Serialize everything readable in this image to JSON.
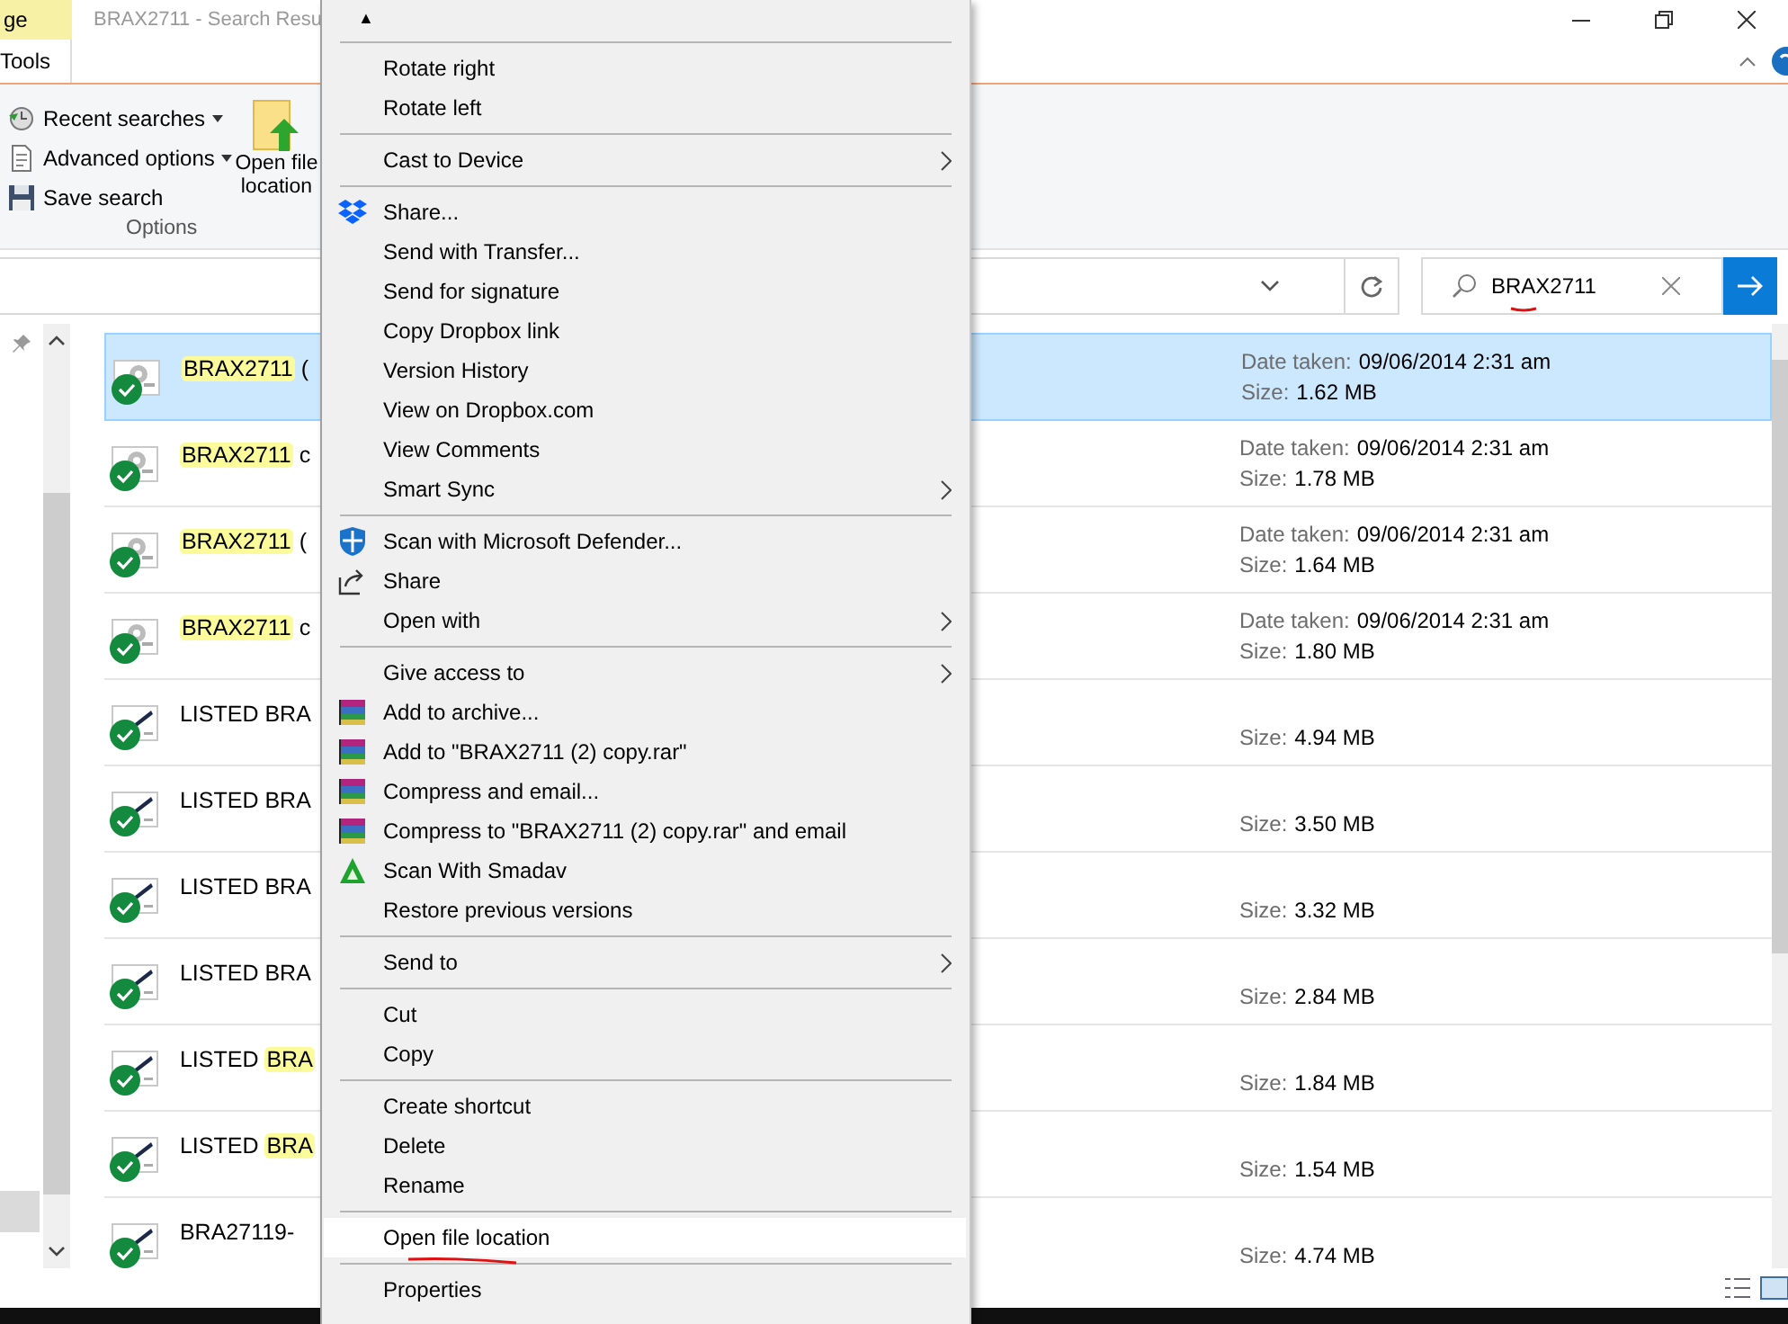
{
  "title_bar": {
    "context_tab": "ge",
    "title": "BRAX2711 - Search Resu"
  },
  "ribbon": {
    "tab": "Tools",
    "group_label": "Options",
    "commands": [
      {
        "label": "Recent searches",
        "kind": "clock",
        "dropdown": true
      },
      {
        "label": "Advanced options",
        "kind": "document",
        "dropdown": true
      },
      {
        "label": "Save search",
        "kind": "disk",
        "dropdown": false
      }
    ],
    "big_command": {
      "label": "Open file location"
    }
  },
  "search": {
    "value": "BRAX2711",
    "underlined": true
  },
  "files": [
    {
      "name": [
        {
          "text": "BRAX2711",
          "match": true
        },
        {
          "text": " (",
          "match": false
        }
      ],
      "selected": true,
      "kind": "gear",
      "date_label": "Date taken:",
      "date": "09/06/2014 2:31 am",
      "size_label": "Size:",
      "size": "1.62 MB"
    },
    {
      "name": [
        {
          "text": "BRAX2711",
          "match": true
        },
        {
          "text": " c",
          "match": false
        }
      ],
      "selected": false,
      "kind": "gear",
      "date_label": "Date taken:",
      "date": "09/06/2014 2:31 am",
      "size_label": "Size:",
      "size": "1.78 MB"
    },
    {
      "name": [
        {
          "text": "BRAX2711",
          "match": true
        },
        {
          "text": " (",
          "match": false
        }
      ],
      "selected": false,
      "kind": "gear",
      "date_label": "Date taken:",
      "date": "09/06/2014 2:31 am",
      "size_label": "Size:",
      "size": "1.64 MB"
    },
    {
      "name": [
        {
          "text": "BRAX2711",
          "match": true
        },
        {
          "text": " c",
          "match": false
        }
      ],
      "selected": false,
      "kind": "gear",
      "date_label": "Date taken:",
      "date": "09/06/2014 2:31 am",
      "size_label": "Size:",
      "size": "1.80 MB"
    },
    {
      "name": [
        {
          "text": "LISTED BRA",
          "match": false
        }
      ],
      "selected": false,
      "kind": "pen",
      "size_label": "Size:",
      "size": "4.94 MB"
    },
    {
      "name": [
        {
          "text": "LISTED BRA",
          "match": false
        }
      ],
      "selected": false,
      "kind": "pen",
      "size_label": "Size:",
      "size": "3.50 MB"
    },
    {
      "name": [
        {
          "text": "LISTED BRA",
          "match": false
        }
      ],
      "selected": false,
      "kind": "pen",
      "size_label": "Size:",
      "size": "3.32 MB"
    },
    {
      "name": [
        {
          "text": "LISTED BRA",
          "match": false
        }
      ],
      "selected": false,
      "kind": "pen",
      "size_label": "Size:",
      "size": "2.84 MB"
    },
    {
      "name": [
        {
          "text": "LISTED ",
          "match": false
        },
        {
          "text": "BRA",
          "match": true
        }
      ],
      "selected": false,
      "kind": "pen",
      "size_label": "Size:",
      "size": "1.84 MB"
    },
    {
      "name": [
        {
          "text": "LISTED ",
          "match": false
        },
        {
          "text": "BRA",
          "match": true
        }
      ],
      "selected": false,
      "kind": "pen",
      "size_label": "Size:",
      "size": "1.54 MB"
    },
    {
      "name": [
        {
          "text": "BRA27119-",
          "match": false
        }
      ],
      "selected": false,
      "kind": "pen",
      "size_label": "Size:",
      "size": "4.74 MB"
    }
  ],
  "context_menu": {
    "items": [
      {
        "kind": "scroll",
        "label": "▲"
      },
      {
        "kind": "separator"
      },
      {
        "kind": "item",
        "label": "Rotate right",
        "submenu": false,
        "selected": false
      },
      {
        "kind": "item",
        "label": "Rotate left",
        "submenu": false,
        "selected": false
      },
      {
        "kind": "separator"
      },
      {
        "kind": "item",
        "label": "Cast to Device",
        "submenu": true,
        "selected": false
      },
      {
        "kind": "separator"
      },
      {
        "kind": "dropbox",
        "label": "Share...",
        "submenu": false,
        "selected": false
      },
      {
        "kind": "item",
        "label": "Send with Transfer...",
        "submenu": false,
        "selected": false
      },
      {
        "kind": "item",
        "label": "Send for signature",
        "submenu": false,
        "selected": false
      },
      {
        "kind": "item",
        "label": "Copy Dropbox link",
        "submenu": false,
        "selected": false
      },
      {
        "kind": "item",
        "label": "Version History",
        "submenu": false,
        "selected": false
      },
      {
        "kind": "item",
        "label": "View on Dropbox.com",
        "submenu": false,
        "selected": false
      },
      {
        "kind": "item",
        "label": "View Comments",
        "submenu": false,
        "selected": false
      },
      {
        "kind": "item",
        "label": "Smart Sync",
        "submenu": true,
        "selected": false
      },
      {
        "kind": "separator"
      },
      {
        "kind": "defender",
        "label": "Scan with Microsoft Defender...",
        "submenu": false,
        "selected": false
      },
      {
        "kind": "share",
        "label": "Share",
        "submenu": false,
        "selected": false
      },
      {
        "kind": "item",
        "label": "Open with",
        "submenu": true,
        "selected": false
      },
      {
        "kind": "separator"
      },
      {
        "kind": "item",
        "label": "Give access to",
        "submenu": true,
        "selected": false
      },
      {
        "kind": "winrar",
        "label": "Add to archive...",
        "submenu": false,
        "selected": false
      },
      {
        "kind": "winrar",
        "label": "Add to \"BRAX2711 (2) copy.rar\"",
        "submenu": false,
        "selected": false
      },
      {
        "kind": "winrar",
        "label": "Compress and email...",
        "submenu": false,
        "selected": false
      },
      {
        "kind": "winrar",
        "label": "Compress to \"BRAX2711 (2) copy.rar\" and email",
        "submenu": false,
        "selected": false
      },
      {
        "kind": "smadav",
        "label": "Scan With Smadav",
        "submenu": false,
        "selected": false
      },
      {
        "kind": "item",
        "label": "Restore previous versions",
        "submenu": false,
        "selected": false
      },
      {
        "kind": "separator"
      },
      {
        "kind": "item",
        "label": "Send to",
        "submenu": true,
        "selected": false
      },
      {
        "kind": "separator"
      },
      {
        "kind": "item",
        "label": "Cut",
        "submenu": false,
        "selected": false
      },
      {
        "kind": "item",
        "label": "Copy",
        "submenu": false,
        "selected": false
      },
      {
        "kind": "separator"
      },
      {
        "kind": "item",
        "label": "Create shortcut",
        "submenu": false,
        "selected": false
      },
      {
        "kind": "item",
        "label": "Delete",
        "submenu": false,
        "selected": false
      },
      {
        "kind": "item",
        "label": "Rename",
        "submenu": false,
        "selected": false
      },
      {
        "kind": "separator"
      },
      {
        "kind": "item",
        "label": "Open file location",
        "submenu": false,
        "selected": true,
        "underlined": true
      },
      {
        "kind": "separator"
      },
      {
        "kind": "item",
        "label": "Properties",
        "submenu": false,
        "selected": false
      }
    ]
  }
}
